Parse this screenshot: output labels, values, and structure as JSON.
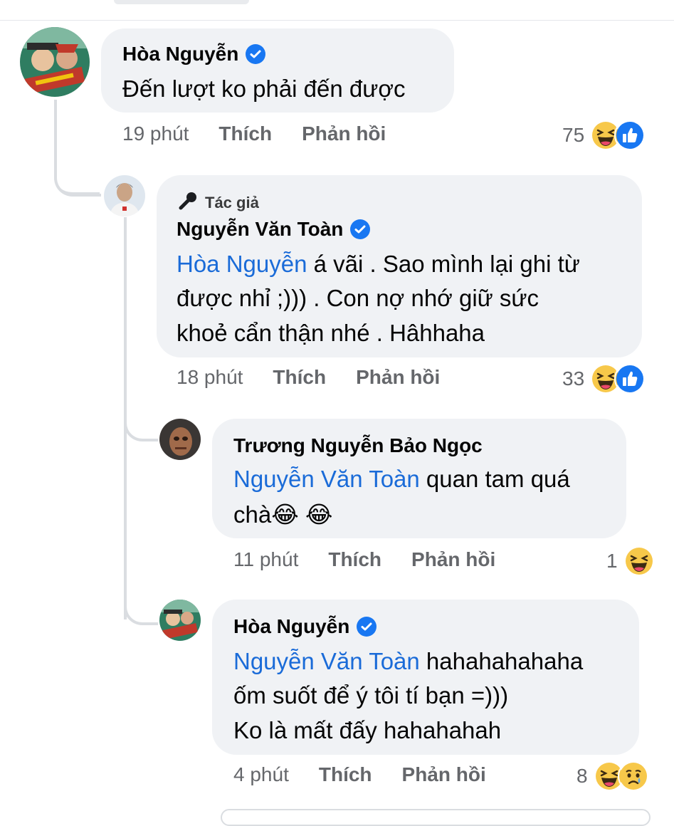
{
  "comments": [
    {
      "author": "Hòa Nguyễn",
      "verified": true,
      "author_tag": "",
      "text_lines": [
        "Đến lượt ko phải đến được"
      ],
      "time": "19 phút",
      "like_label": "Thích",
      "reply_label": "Phản hồi",
      "reaction_count": "75",
      "reactions": [
        "haha-icon",
        "like-icon"
      ]
    },
    {
      "author": "Nguyễn Văn Toàn",
      "verified": true,
      "author_tag": "Tác giả",
      "mention": "Hòa Nguyễn",
      "text_lines": [
        " á vãi . Sao mình lại ghi từ",
        "được nhỉ ;))) . Con nợ nhớ giữ sức",
        "khoẻ cẩn thận nhé . Hâhhaha"
      ],
      "time": "18 phút",
      "like_label": "Thích",
      "reply_label": "Phản hồi",
      "reaction_count": "33",
      "reactions": [
        "haha-icon",
        "like-icon"
      ]
    },
    {
      "author": "Trương Nguyễn Bảo Ngọc",
      "verified": false,
      "mention": "Nguyễn Văn Toàn",
      "text_lines": [
        " quan tam quá",
        "chà😂 😂"
      ],
      "time": "11 phút",
      "like_label": "Thích",
      "reply_label": "Phản hồi",
      "reaction_count": "1",
      "reactions": [
        "haha-icon"
      ]
    },
    {
      "author": "Hòa Nguyễn",
      "verified": true,
      "mention": "Nguyễn Văn Toàn",
      "text_lines": [
        " hahahahahaha",
        "ốm suốt để ý tôi tí bạn =)))",
        "Ko là mất đấy hahahahah"
      ],
      "time": "4 phút",
      "like_label": "Thích",
      "reply_label": "Phản hồi",
      "reaction_count": "8",
      "reactions": [
        "haha-icon",
        "sad-icon"
      ]
    }
  ],
  "colors": {
    "bubble": "#f0f2f5",
    "mention": "#1a6bd8",
    "meta": "#65676b",
    "verified": "#1877f2"
  }
}
